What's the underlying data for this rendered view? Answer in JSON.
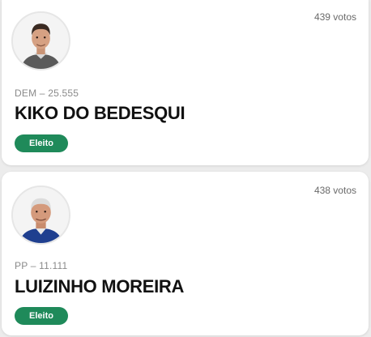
{
  "candidates": [
    {
      "votes": "439 votos",
      "party": "DEM – 25.555",
      "name": "KIKO DO BEDESQUI",
      "status": "Eleito"
    },
    {
      "votes": "438 votos",
      "party": "PP – 11.111",
      "name": "LUIZINHO MOREIRA",
      "status": "Eleito"
    }
  ],
  "colors": {
    "elected_badge": "#1f8a5a",
    "card_background": "#ffffff",
    "page_background": "#ececec"
  },
  "icons": [
    "candidate-photo",
    "candidate-photo"
  ]
}
